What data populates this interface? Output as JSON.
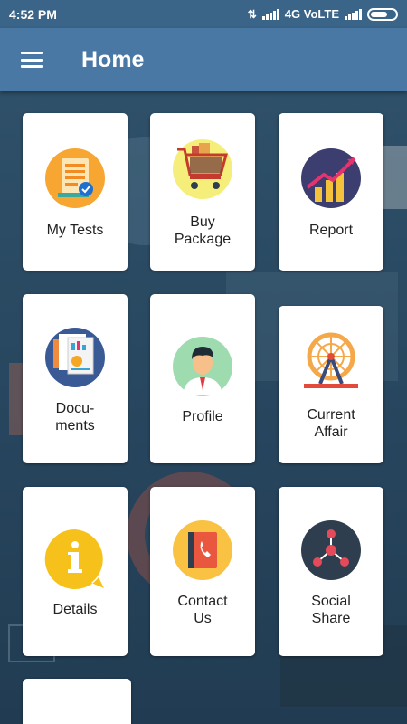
{
  "status": {
    "time": "4:52 PM",
    "network": "4G VoLTE"
  },
  "app_bar": {
    "title": "Home"
  },
  "tiles": [
    {
      "label": "My Tests",
      "icon": "test-document-icon"
    },
    {
      "label": "Buy\nPackage",
      "icon": "shopping-cart-icon"
    },
    {
      "label": "Report",
      "icon": "growth-chart-icon"
    },
    {
      "label": "Docu-\nments",
      "icon": "documents-icon"
    },
    {
      "label": "Profile",
      "icon": "user-avatar-icon"
    },
    {
      "label": "Current\nAffair",
      "icon": "ferris-wheel-icon"
    },
    {
      "label": "Details",
      "icon": "info-bubble-icon"
    },
    {
      "label": "Contact\nUs",
      "icon": "contact-book-icon"
    },
    {
      "label": "Social\nShare",
      "icon": "share-network-icon"
    }
  ],
  "colors": {
    "status_bar": "#3a6488",
    "app_bar": "#4a78a5",
    "background": "#2c4a5e",
    "card": "#ffffff"
  }
}
